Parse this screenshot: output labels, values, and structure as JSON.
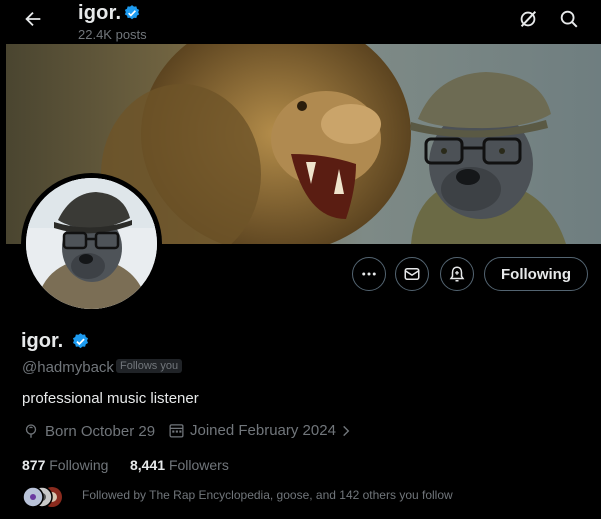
{
  "header": {
    "display_name": "igor.",
    "posts_count": "22.4K posts"
  },
  "profile": {
    "display_name": "igor.",
    "handle": "@hadmyback",
    "follows_you": "Follows you",
    "bio": "professional music listener",
    "born": "Born October 29",
    "joined": "Joined February 2024",
    "following_count": "877",
    "following_label": "Following",
    "followers_count": "8,441",
    "followers_label": "Followers",
    "followed_by": "Followed by The Rap Encyclopedia, goose, and 142 others you follow"
  },
  "actions": {
    "follow_button_label": "Following"
  },
  "colors": {
    "background": "#000000",
    "verified": "#1d9bf0",
    "secondary_text": "#71767b",
    "border": "#536471"
  },
  "icons": [
    "back-arrow-icon",
    "verified-badge-icon",
    "grok-icon",
    "search-icon",
    "more-icon",
    "mail-icon",
    "notification-bell-icon",
    "calendar-icon",
    "birthday-icon",
    "chevron-right-icon"
  ]
}
